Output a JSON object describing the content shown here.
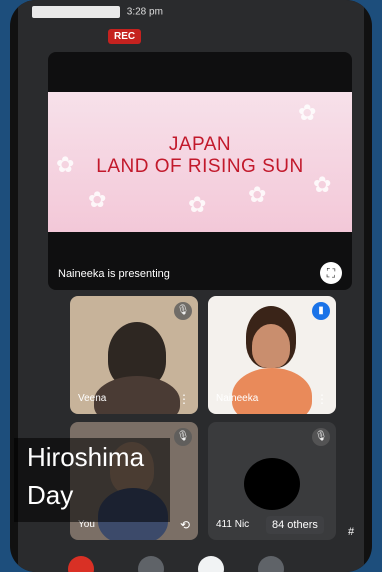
{
  "status": {
    "time": "3:28 pm"
  },
  "recording": {
    "label": "REC"
  },
  "presentation": {
    "slide_line1": "JAPAN",
    "slide_line2": "LAND OF RISING SUN",
    "presenter_label": "Naineeka is presenting",
    "fullscreen_icon": "fullscreen-icon"
  },
  "participants": [
    {
      "name": "Veena",
      "mic": "muted"
    },
    {
      "name": "Naineeka",
      "mic": "speaking"
    },
    {
      "name": "You",
      "mic": "muted"
    },
    {
      "name": "411 Nic",
      "mic": "muted"
    }
  ],
  "overlay": {
    "line1": "Hiroshima",
    "line2": "Day"
  },
  "others_badge": "84 others",
  "hash_label": "#",
  "colors": {
    "rec": "#c5221f",
    "speaking_mic": "#1a73e8",
    "slide_text": "#c2192b"
  }
}
